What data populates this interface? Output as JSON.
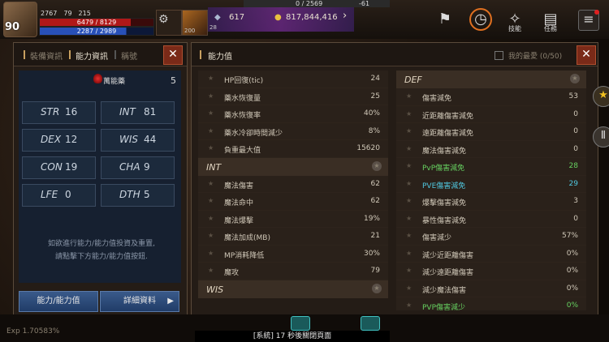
{
  "hud": {
    "level": "90",
    "mini": [
      "2767",
      "79",
      "215"
    ],
    "hp": "6479 / 8129",
    "mp": "2287 / 2989",
    "exp_top_left": "0 / 2569",
    "exp_top_right": "-61",
    "item_count": "200",
    "item_count2": "28",
    "gems": "617",
    "gold": "817,844,416",
    "icons": [
      {
        "name": "skill-icon",
        "label": "技能"
      },
      {
        "name": "quest-icon",
        "label": "任務"
      }
    ],
    "menu_glyph": "≡"
  },
  "left": {
    "tabs": [
      "裝備資訊",
      "能力資訊",
      "稱號"
    ],
    "active_tab": 1,
    "close": "✕",
    "potion_label": "萬能藥",
    "potion_value": "5",
    "stats": [
      {
        "name": "STR",
        "value": "16"
      },
      {
        "name": "INT",
        "value": "81"
      },
      {
        "name": "DEX",
        "value": "12"
      },
      {
        "name": "WIS",
        "value": "44"
      },
      {
        "name": "CON",
        "value": "19"
      },
      {
        "name": "CHA",
        "value": "9"
      },
      {
        "name": "LFE",
        "value": "0"
      },
      {
        "name": "DTH",
        "value": "5"
      }
    ],
    "hint_1": "如欲進行能力/能力值投資及重置,",
    "hint_2": "請點擊下方能力/能力值按鈕.",
    "btn_ability": "能力/能力值",
    "btn_detail": "詳細資料"
  },
  "right": {
    "title": "能力值",
    "fav_label": "我的最愛 (0/50)",
    "close": "✕",
    "left_col": [
      {
        "type": "row",
        "label": "HP回復(tic)",
        "value": "24"
      },
      {
        "type": "row",
        "label": "藥水恢復量",
        "value": "25"
      },
      {
        "type": "row",
        "label": "藥水恢復率",
        "value": "40%"
      },
      {
        "type": "row",
        "label": "藥水冷卻時間減少",
        "value": "8%"
      },
      {
        "type": "row",
        "label": "負重最大值",
        "value": "15620"
      },
      {
        "type": "sect",
        "label": "INT"
      },
      {
        "type": "row",
        "label": "魔法傷害",
        "value": "62"
      },
      {
        "type": "row",
        "label": "魔法命中",
        "value": "62"
      },
      {
        "type": "row",
        "label": "魔法爆擊",
        "value": "19%"
      },
      {
        "type": "row",
        "label": "魔法加成(MB)",
        "value": "21"
      },
      {
        "type": "row",
        "label": "MP消耗降低",
        "value": "30%"
      },
      {
        "type": "row",
        "label": "魔攻",
        "value": "79"
      },
      {
        "type": "sect",
        "label": "WIS"
      }
    ],
    "right_col": [
      {
        "type": "sect",
        "label": "DEF"
      },
      {
        "type": "row",
        "label": "傷害減免",
        "value": "53"
      },
      {
        "type": "row",
        "label": "近距離傷害減免",
        "value": "0"
      },
      {
        "type": "row",
        "label": "遠距離傷害減免",
        "value": "0"
      },
      {
        "type": "row",
        "label": "魔法傷害減免",
        "value": "0"
      },
      {
        "type": "row",
        "label": "PvP傷害減免",
        "value": "28",
        "color": "green"
      },
      {
        "type": "row",
        "label": "PVE傷害減免",
        "value": "29",
        "color": "cyan"
      },
      {
        "type": "row",
        "label": "爆擊傷害減免",
        "value": "3"
      },
      {
        "type": "row",
        "label": "暴性傷害減免",
        "value": "0"
      },
      {
        "type": "row",
        "label": "傷害減少",
        "value": "57%"
      },
      {
        "type": "row",
        "label": "減少近距離傷害",
        "value": "0%"
      },
      {
        "type": "row",
        "label": "減少遠距離傷害",
        "value": "0%"
      },
      {
        "type": "row",
        "label": "減少魔法傷害",
        "value": "0%"
      },
      {
        "type": "row",
        "label": "PVP傷害減少",
        "value": "0%",
        "color": "green"
      }
    ]
  },
  "bottom": {
    "exp": "Exp 1.70583%",
    "system_msg": "[系統] 17 秒後關閉頁面"
  }
}
